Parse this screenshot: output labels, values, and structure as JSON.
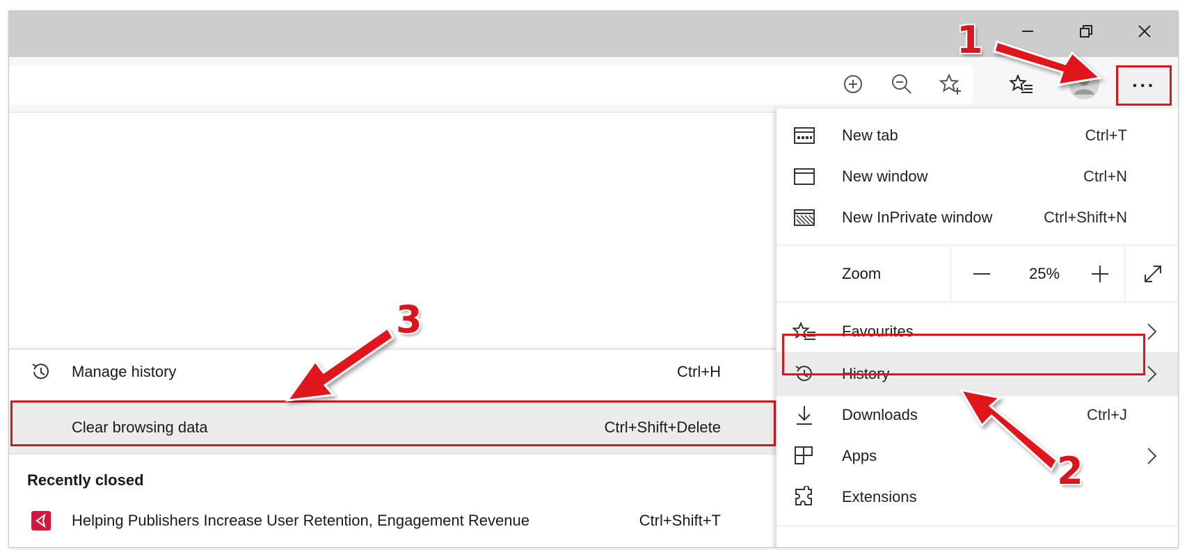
{
  "window": {
    "minimize_glyph": "–",
    "restore_glyph": "❐",
    "close_glyph": "✕"
  },
  "toolbar": {
    "icons": [
      "add-icon",
      "zoom-out-icon",
      "add-favourite-icon",
      "favourites-icon",
      "profile-icon"
    ],
    "more_label": "···"
  },
  "menu": {
    "items": [
      {
        "label": "New tab",
        "shortcut": "Ctrl+T",
        "icon": "new-tab-icon"
      },
      {
        "label": "New window",
        "shortcut": "Ctrl+N",
        "icon": "new-window-icon"
      },
      {
        "label": "New InPrivate window",
        "shortcut": "Ctrl+Shift+N",
        "icon": "inprivate-icon"
      }
    ],
    "zoom": {
      "label": "Zoom",
      "minus": "—",
      "value": "25%",
      "plus": "+"
    },
    "items2": [
      {
        "label": "Favourites",
        "icon": "favourites-icon"
      },
      {
        "label": "History",
        "icon": "history-icon"
      },
      {
        "label": "Downloads",
        "shortcut": "Ctrl+J",
        "icon": "download-icon"
      },
      {
        "label": "Apps",
        "icon": "apps-icon"
      },
      {
        "label": "Extensions",
        "icon": "extensions-icon"
      }
    ]
  },
  "history_submenu": {
    "manage": {
      "label": "Manage history",
      "shortcut": "Ctrl+H"
    },
    "clear": {
      "label": "Clear browsing data",
      "shortcut": "Ctrl+Shift+Delete"
    },
    "recently_closed_heading": "Recently closed",
    "recent": [
      {
        "label": "Helping Publishers Increase User Retention, Engagement  Revenue",
        "shortcut": "Ctrl+Shift+T"
      }
    ]
  },
  "annotations": {
    "step1": "1",
    "step2": "2",
    "step3": "3"
  },
  "colors": {
    "annotation_red": "#d7161e",
    "site_icon": "#d2173d"
  }
}
